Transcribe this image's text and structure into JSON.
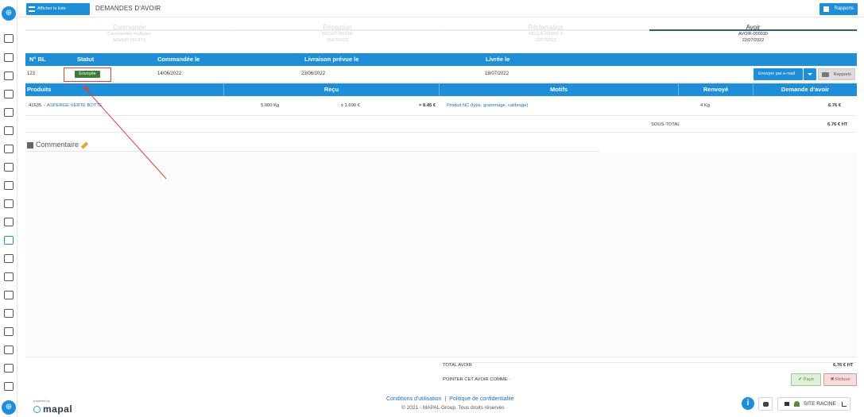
{
  "topbar": {
    "show_list_label": "Afficher la liste",
    "page_title": "DEMANDES D'AVOIR",
    "reports_label": "Rapports"
  },
  "steps": [
    {
      "label": "Commande",
      "sub1": "Commandes multiples",
      "sub2": "ARMOR FRUITS"
    },
    {
      "label": "Réception",
      "sub1": "RECEP-000000",
      "sub2": "18/07/2022"
    },
    {
      "label": "Réclamation",
      "sub1": "RECLA-000000-1",
      "sub2": "22/07/2022"
    },
    {
      "label": "Avoir",
      "sub1": "AVOIR-000030",
      "sub2": "22/07/2022"
    }
  ],
  "bl_table": {
    "headers": {
      "num": "N° BL",
      "status": "Statut",
      "ordered": "Commandée le",
      "planned": "Livraison prévue le",
      "delivered": "Livrée le"
    },
    "row": {
      "num": "123",
      "status": "Envoyée",
      "ordered": "14/06/2022",
      "planned": "23/06/2022",
      "delivered": "18/07/2022"
    },
    "send_email_label": "Envoyer par e-mail",
    "reports_label": "Rapports"
  },
  "products_table": {
    "headers": {
      "products": "Produits",
      "received": "Reçu",
      "reasons": "Motifs",
      "returned": "Renvoyé",
      "credit_request": "Demande d'avoir"
    },
    "row": {
      "code": "41635",
      "name": "ASPERGE VERTE BOTTE",
      "quantity": "5.000 Kg",
      "unit_price": "x 1.690 €",
      "total": "= 8.45 €",
      "reason": "Produit NC (type, grammage, calibrage)",
      "returned": "4 Kg",
      "credit_amount": "6.76 €"
    },
    "subtotal_label": "SOUS-TOTAL",
    "subtotal_value": "6.76 € HT"
  },
  "comment": {
    "title": "Commentaire"
  },
  "totals": {
    "total_label": "TOTAL AVOIR",
    "total_value": "6.76 € HT",
    "pointer_label": "POINTER CET AVOIR COMME :",
    "paid_label": "Payé",
    "refused_label": "Refusé"
  },
  "footer": {
    "terms": "Conditions d'utilisation",
    "separator": "|",
    "privacy": "Politique de confidentialité",
    "copyright": "© 2021 - MAPAL Group. Tous droits réservés",
    "powered_by": "powered by",
    "brand": "mapal",
    "site_label": "SITE RACINE"
  },
  "colors": {
    "primary": "#1f8ed8",
    "status_green": "#3d7d34",
    "annotation_red": "#d9453a"
  },
  "icons": [
    "logo-icon",
    "list-icon",
    "reports-icon",
    "printer-icon",
    "comment-icon",
    "pencil-icon",
    "info-icon",
    "chef-icon",
    "home-icon",
    "tree-icon",
    "chart-icon",
    "check-icon",
    "x-icon"
  ]
}
